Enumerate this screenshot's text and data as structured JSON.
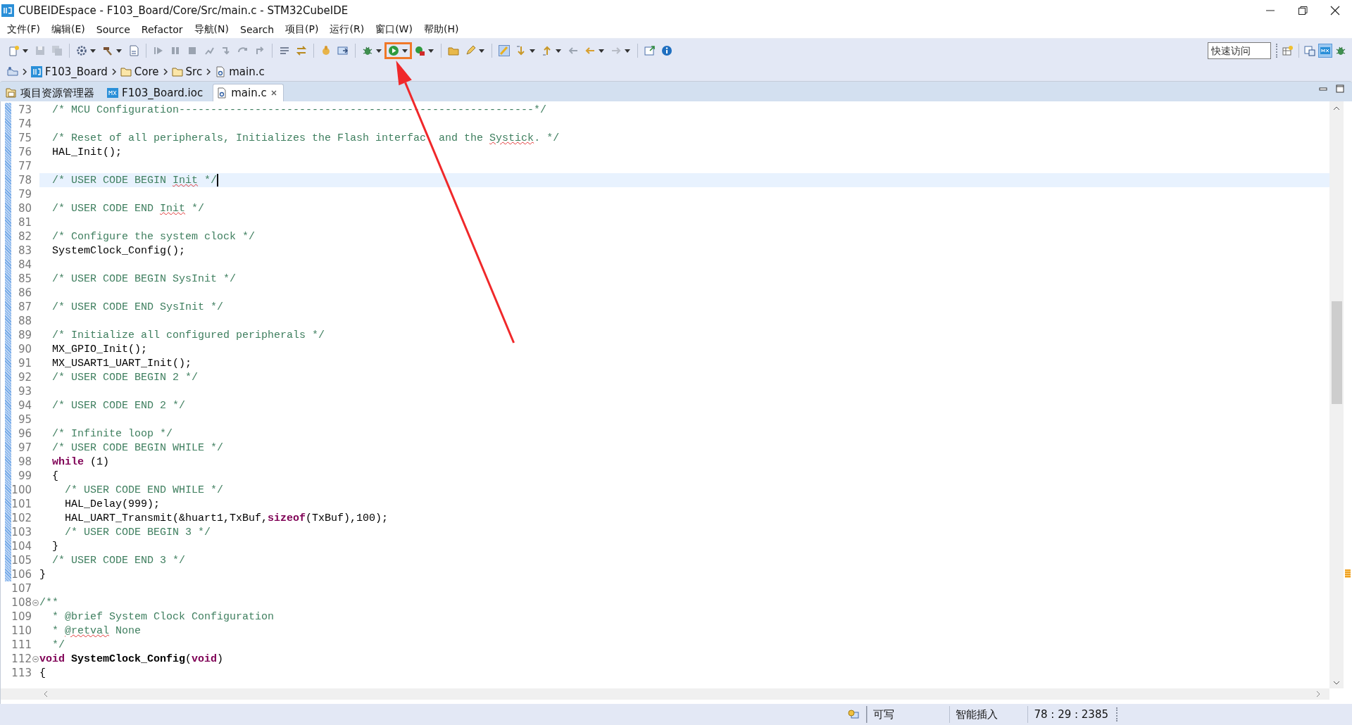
{
  "window": {
    "title": "CUBEIDEspace - F103_Board/Core/Src/main.c - STM32CubeIDE"
  },
  "menu": [
    "文件(F)",
    "编辑(E)",
    "Source",
    "Refactor",
    "导航(N)",
    "Search",
    "项目(P)",
    "运行(R)",
    "窗口(W)",
    "帮助(H)"
  ],
  "quick_access": {
    "placeholder": "快速访问"
  },
  "breadcrumb": [
    {
      "kind": "project",
      "label": "F103_Board"
    },
    {
      "kind": "folder",
      "label": "Core"
    },
    {
      "kind": "folder",
      "label": "Src"
    },
    {
      "kind": "file",
      "label": "main.c"
    }
  ],
  "tabs": [
    {
      "kind": "explorer",
      "label": "项目资源管理器",
      "selected": false
    },
    {
      "kind": "ioc",
      "label": "F103_Board.ioc",
      "selected": false
    },
    {
      "kind": "source",
      "label": "main.c",
      "selected": true
    }
  ],
  "editor": {
    "lines": [
      {
        "number": "73",
        "changed": true,
        "current": false,
        "segments": [
          {
            "kind": "comment",
            "text": "  /* MCU Configuration--------------------------------------------------------*/"
          }
        ]
      },
      {
        "number": "74",
        "changed": true,
        "current": false
      },
      {
        "number": "75",
        "changed": true,
        "current": false,
        "segments": [
          {
            "kind": "comment",
            "text": "  /* Reset of all peripherals, Initializes the Flash interfac"
          },
          {
            "kind": "covered"
          },
          {
            "kind": "comment",
            "text": " and the "
          },
          {
            "kind": "squiggle",
            "text": "Systick"
          },
          {
            "kind": "comment",
            "text": ". */"
          }
        ]
      },
      {
        "number": "76",
        "changed": true,
        "current": false,
        "segments": [
          {
            "kind": "plain",
            "text": "  HAL_Init();"
          }
        ]
      },
      {
        "number": "77",
        "changed": true,
        "current": false
      },
      {
        "number": "78",
        "changed": true,
        "current": true,
        "segments": [
          {
            "kind": "comment",
            "text": "  /* USER CODE BEGIN "
          },
          {
            "kind": "squiggle",
            "text": "Init"
          },
          {
            "kind": "comment",
            "text": " */"
          }
        ]
      },
      {
        "number": "79",
        "changed": true,
        "current": false
      },
      {
        "number": "80",
        "changed": true,
        "current": false,
        "segments": [
          {
            "kind": "comment",
            "text": "  /* USER CODE END "
          },
          {
            "kind": "squiggle",
            "text": "Init"
          },
          {
            "kind": "comment",
            "text": " */"
          }
        ]
      },
      {
        "number": "81",
        "changed": true,
        "current": false
      },
      {
        "number": "82",
        "changed": true,
        "current": false,
        "segments": [
          {
            "kind": "comment",
            "text": "  /* Configure the system clock */"
          }
        ]
      },
      {
        "number": "83",
        "changed": true,
        "current": false,
        "segments": [
          {
            "kind": "plain",
            "text": "  SystemClock_Config();"
          }
        ]
      },
      {
        "number": "84",
        "changed": true,
        "current": false
      },
      {
        "number": "85",
        "changed": true,
        "current": false,
        "segments": [
          {
            "kind": "comment",
            "text": "  /* USER CODE BEGIN SysInit */"
          }
        ]
      },
      {
        "number": "86",
        "changed": true,
        "current": false
      },
      {
        "number": "87",
        "changed": true,
        "current": false,
        "segments": [
          {
            "kind": "comment",
            "text": "  /* USER CODE END SysInit */"
          }
        ]
      },
      {
        "number": "88",
        "changed": true,
        "current": false
      },
      {
        "number": "89",
        "changed": true,
        "current": false,
        "segments": [
          {
            "kind": "comment",
            "text": "  /* Initialize all configured peripherals */"
          }
        ]
      },
      {
        "number": "90",
        "changed": true,
        "current": false,
        "segments": [
          {
            "kind": "plain",
            "text": "  MX_GPIO_Init();"
          }
        ]
      },
      {
        "number": "91",
        "changed": true,
        "current": false,
        "segments": [
          {
            "kind": "plain",
            "text": "  MX_USART1_UART_Init();"
          }
        ]
      },
      {
        "number": "92",
        "changed": true,
        "current": false,
        "segments": [
          {
            "kind": "comment",
            "text": "  /* USER CODE BEGIN 2 */"
          }
        ]
      },
      {
        "number": "93",
        "changed": true,
        "current": false
      },
      {
        "number": "94",
        "changed": true,
        "current": false,
        "segments": [
          {
            "kind": "comment",
            "text": "  /* USER CODE END 2 */"
          }
        ]
      },
      {
        "number": "95",
        "changed": true,
        "current": false
      },
      {
        "number": "96",
        "changed": true,
        "current": false,
        "segments": [
          {
            "kind": "comment",
            "text": "  /* Infinite loop */"
          }
        ]
      },
      {
        "number": "97",
        "changed": true,
        "current": false,
        "segments": [
          {
            "kind": "comment",
            "text": "  /* USER CODE BEGIN WHILE */"
          }
        ]
      },
      {
        "number": "98",
        "changed": true,
        "current": false,
        "segments": [
          {
            "kind": "keyword",
            "text": "  while"
          },
          {
            "kind": "plain",
            "text": " (1)"
          }
        ]
      },
      {
        "number": "99",
        "changed": true,
        "current": false,
        "segments": [
          {
            "kind": "plain",
            "text": "  {"
          }
        ]
      },
      {
        "number": "100",
        "changed": true,
        "current": false,
        "segments": [
          {
            "kind": "comment",
            "text": "    /* USER CODE END WHILE */"
          }
        ]
      },
      {
        "number": "101",
        "changed": true,
        "current": false,
        "segments": [
          {
            "kind": "plain",
            "text": "    HAL_Delay(999);"
          }
        ]
      },
      {
        "number": "102",
        "changed": true,
        "current": false,
        "segments": [
          {
            "kind": "plain",
            "text": "    HAL_UART_Transmit(&huart1,TxBuf,"
          },
          {
            "kind": "keyword",
            "text": "sizeof"
          },
          {
            "kind": "plain",
            "text": "(TxBuf),100);"
          }
        ]
      },
      {
        "number": "103",
        "changed": true,
        "current": false,
        "segments": [
          {
            "kind": "comment",
            "text": "    /* USER CODE BEGIN 3 */"
          }
        ]
      },
      {
        "number": "104",
        "changed": true,
        "current": false,
        "segments": [
          {
            "kind": "plain",
            "text": "  }"
          }
        ]
      },
      {
        "number": "105",
        "changed": true,
        "current": false,
        "segments": [
          {
            "kind": "comment",
            "text": "  /* USER CODE END 3 */"
          }
        ]
      },
      {
        "number": "106",
        "changed": true,
        "current": false,
        "segments": [
          {
            "kind": "plain",
            "text": "}"
          }
        ]
      },
      {
        "number": "107",
        "changed": false,
        "current": false
      },
      {
        "number": "108",
        "changed": false,
        "current": false,
        "folded": false,
        "segments": [
          {
            "kind": "comment",
            "text": "/**"
          }
        ]
      },
      {
        "number": "109",
        "changed": false,
        "current": false,
        "segments": [
          {
            "kind": "comment",
            "text": "  * @brief System Clock Configuration"
          }
        ]
      },
      {
        "number": "110",
        "changed": false,
        "current": false,
        "segments": [
          {
            "kind": "comment",
            "text": "  * "
          },
          {
            "kind": "squiggle",
            "text": "@retval"
          },
          {
            "kind": "comment",
            "text": " None"
          }
        ]
      },
      {
        "number": "111",
        "changed": false,
        "current": false,
        "segments": [
          {
            "kind": "comment",
            "text": "  */"
          }
        ]
      },
      {
        "number": "112",
        "changed": false,
        "current": false,
        "folded": false,
        "segments": [
          {
            "kind": "keyword",
            "text": "void"
          },
          {
            "kind": "declaration",
            "text": " SystemClock_Config"
          },
          {
            "kind": "plain",
            "text": "("
          },
          {
            "kind": "keyword",
            "text": "void"
          },
          {
            "kind": "plain",
            "text": ")"
          }
        ]
      },
      {
        "number": "113",
        "changed": false,
        "current": false,
        "segments": [
          {
            "kind": "plain",
            "text": "{"
          }
        ]
      }
    ]
  },
  "status_bar": [
    "可写",
    "智能插入",
    "78 : 29 : 2385"
  ]
}
